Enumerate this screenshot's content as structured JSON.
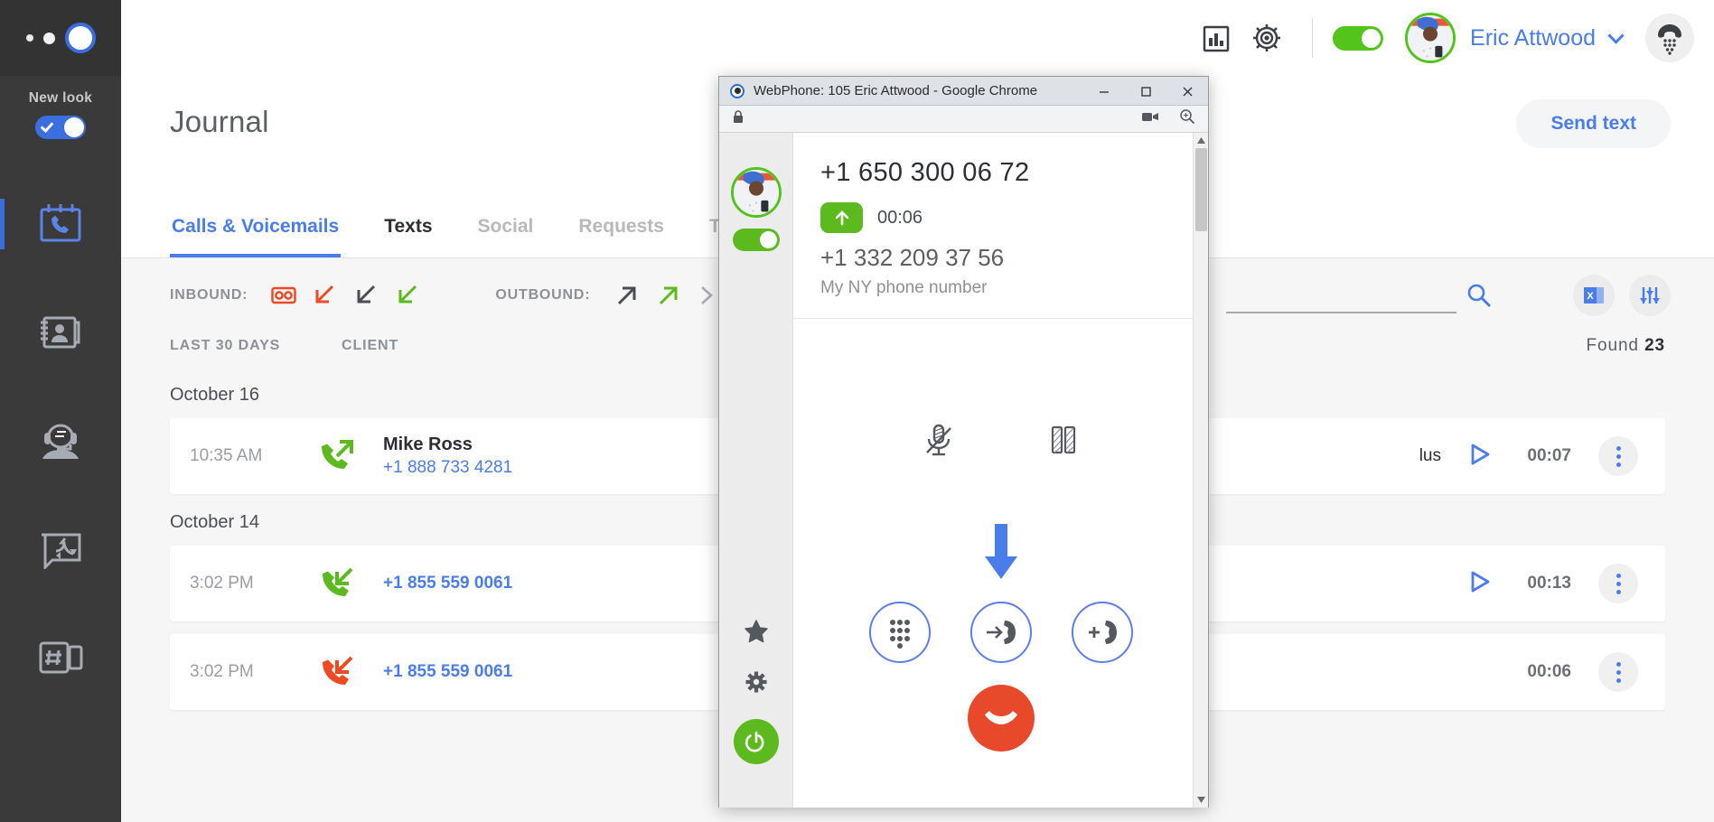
{
  "leftnav": {
    "new_look_label": "New look",
    "items": [
      {
        "name": "journal",
        "icon": "calendar-phone-icon",
        "active": true
      },
      {
        "name": "contacts",
        "icon": "address-book-icon",
        "active": false
      },
      {
        "name": "agent",
        "icon": "headset-agent-icon",
        "active": false
      },
      {
        "name": "routing",
        "icon": "call-flow-icon",
        "active": false
      },
      {
        "name": "numbers",
        "icon": "sms-device-icon",
        "active": false
      }
    ]
  },
  "header": {
    "stats_icon": "bar-chart-icon",
    "settings_icon": "gear-icon",
    "status_toggle": "on",
    "user_name": "Eric Attwood",
    "chevron_icon": "chevron-down-icon",
    "dialpad_icon": "phone-dialpad-icon",
    "accent_color": "#4a7dec",
    "green_color": "#52c41a"
  },
  "page": {
    "title": "Journal",
    "send_text_label": "Send text",
    "tabs": [
      {
        "label": "Calls & Voicemails",
        "state": "active"
      },
      {
        "label": "Texts",
        "state": "dark"
      },
      {
        "label": "Social",
        "state": "muted"
      },
      {
        "label": "Requests",
        "state": "muted"
      },
      {
        "label": "Ta",
        "state": "muted"
      }
    ]
  },
  "filters": {
    "inbound_label": "INBOUND:",
    "outbound_label": "OUTBOUND:",
    "inbound_icons": [
      {
        "name": "voicemail-icon",
        "color": "#f04a24"
      },
      {
        "name": "inbound-missed-arrow-icon",
        "color": "#f04a24"
      },
      {
        "name": "inbound-arrow-icon",
        "color": "#4a4e54"
      },
      {
        "name": "inbound-answered-arrow-icon",
        "color": "#5cba1e"
      }
    ],
    "outbound_icons": [
      {
        "name": "outbound-arrow-icon",
        "color": "#4a4e54"
      },
      {
        "name": "outbound-answered-arrow-icon",
        "color": "#5cba1e"
      }
    ],
    "more_icon": "chevron-right-icon",
    "search_placeholder": "",
    "search_value": "",
    "search_icon": "magnifier-icon",
    "excel_icon": "excel-export-icon",
    "sliders_icon": "filter-sliders-icon"
  },
  "table": {
    "col_period": "LAST 30 DAYS",
    "col_client": "CLIENT",
    "found_label": "Found",
    "found_count": "23",
    "groups": [
      {
        "date": "October 16",
        "rows": [
          {
            "time": "10:35 AM",
            "direction": "outbound-answered",
            "dir_color": "#5cba1e",
            "name": "Mike Ross",
            "number": "+1 888 733 4281",
            "trailing_text": "lus",
            "has_play": true,
            "duration": "00:07"
          }
        ]
      },
      {
        "date": "October 14",
        "rows": [
          {
            "time": "3:02 PM",
            "direction": "inbound-answered",
            "dir_color": "#5cba1e",
            "name": "",
            "number": "+1 855 559 0061",
            "trailing_text": "",
            "has_play": true,
            "duration": "00:13"
          },
          {
            "time": "3:02 PM",
            "direction": "inbound-missed",
            "dir_color": "#f04a24",
            "name": "",
            "number": "+1 855 559 0061",
            "trailing_text": "",
            "has_play": false,
            "duration": "00:06"
          }
        ]
      }
    ]
  },
  "webphone": {
    "window_title": "WebPhone: 105 Eric Attwood - Google Chrome",
    "minimize_icon": "minimize-icon",
    "maximize_icon": "maximize-icon",
    "close_icon": "close-icon",
    "lock_icon": "lock-icon",
    "camera_icon": "camera-icon",
    "zoom_icon": "zoom-icon",
    "rail": {
      "toggle_state": "on",
      "favorites_icon": "star-icon",
      "settings_icon": "gear-icon",
      "power_icon": "power-icon"
    },
    "call": {
      "remote_number": "+1 650 300 06 72",
      "direction_icon": "outbound-up-arrow-icon",
      "timer": "00:06",
      "local_number": "+1 332 209 37 56",
      "local_label": "My NY phone number"
    },
    "actions": [
      {
        "name": "mute-icon",
        "label": "mute"
      },
      {
        "name": "hold-icon",
        "label": "hold"
      }
    ],
    "hint_arrow_icon": "blue-down-arrow-icon",
    "controls": [
      {
        "name": "keypad-button",
        "icon": "dialpad-icon"
      },
      {
        "name": "transfer-button",
        "icon": "transfer-call-icon"
      },
      {
        "name": "add-call-button",
        "icon": "add-call-icon"
      }
    ],
    "hangup_icon": "hangup-icon",
    "hangup_color": "#e8492b",
    "scroll_up_icon": "scroll-up-arrow-icon",
    "scroll_down_icon": "scroll-down-arrow-icon"
  }
}
